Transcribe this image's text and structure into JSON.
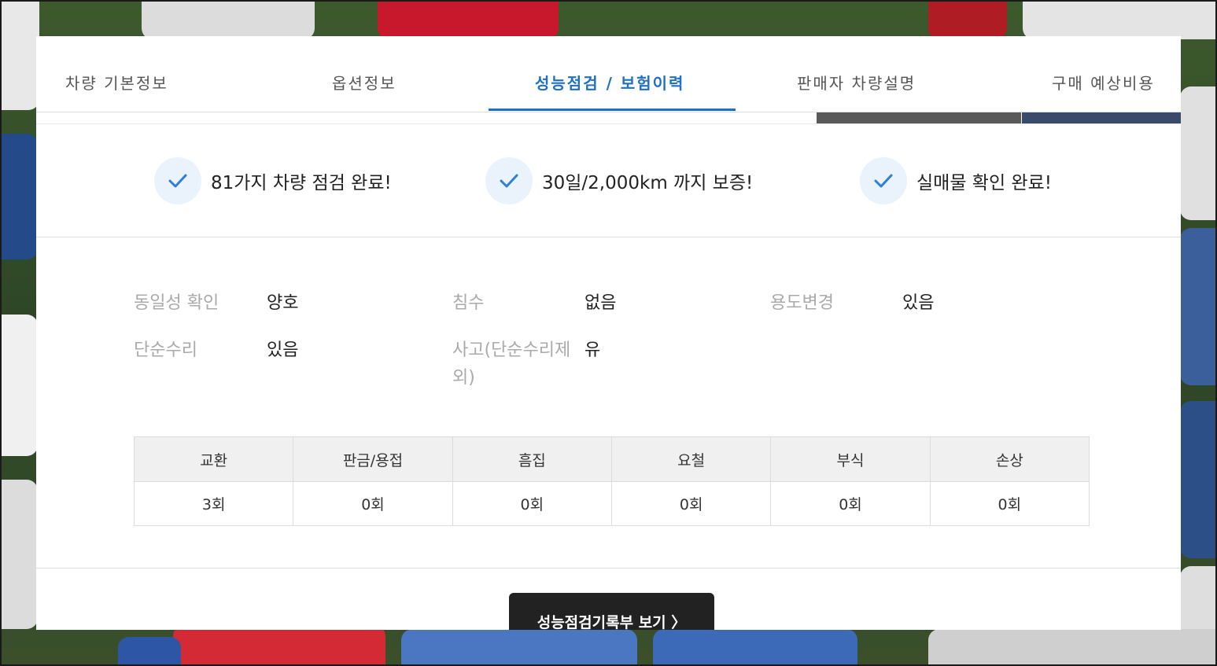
{
  "tabs": [
    {
      "label": "차량 기본정보",
      "active": false
    },
    {
      "label": "옵션정보",
      "active": false
    },
    {
      "label": "성능점검 / 보험이력",
      "active": true
    },
    {
      "label": "판매자 차량설명",
      "active": false
    },
    {
      "label": "구매 예상비용",
      "active": false
    }
  ],
  "highlights": [
    {
      "icon": "check-icon",
      "text": "81가지 차량 점검 완료!"
    },
    {
      "icon": "check-icon",
      "text": "30일/2,000km 까지 보증!"
    },
    {
      "icon": "check-icon",
      "text": "실매물 확인 완료!"
    }
  ],
  "inspection": {
    "identity": {
      "label": "동일성 확인",
      "value": "양호"
    },
    "flood": {
      "label": "침수",
      "value": "없음"
    },
    "usage_change": {
      "label": "용도변경",
      "value": "있음"
    },
    "simple_repair": {
      "label": "단순수리",
      "value": "있음"
    },
    "accident": {
      "label": "사고(단순수리제외)",
      "value": "유"
    }
  },
  "repair_counts": {
    "headers": [
      "교환",
      "판금/용접",
      "흠집",
      "요철",
      "부식",
      "손상"
    ],
    "values": [
      "3회",
      "0회",
      "0회",
      "0회",
      "0회",
      "0회"
    ]
  },
  "record_button": {
    "label": "성능점검기록부 보기 〉"
  },
  "colors": {
    "accent": "#1f6fc4",
    "button_bg": "#222222",
    "check_bg": "#eaf2fc"
  }
}
